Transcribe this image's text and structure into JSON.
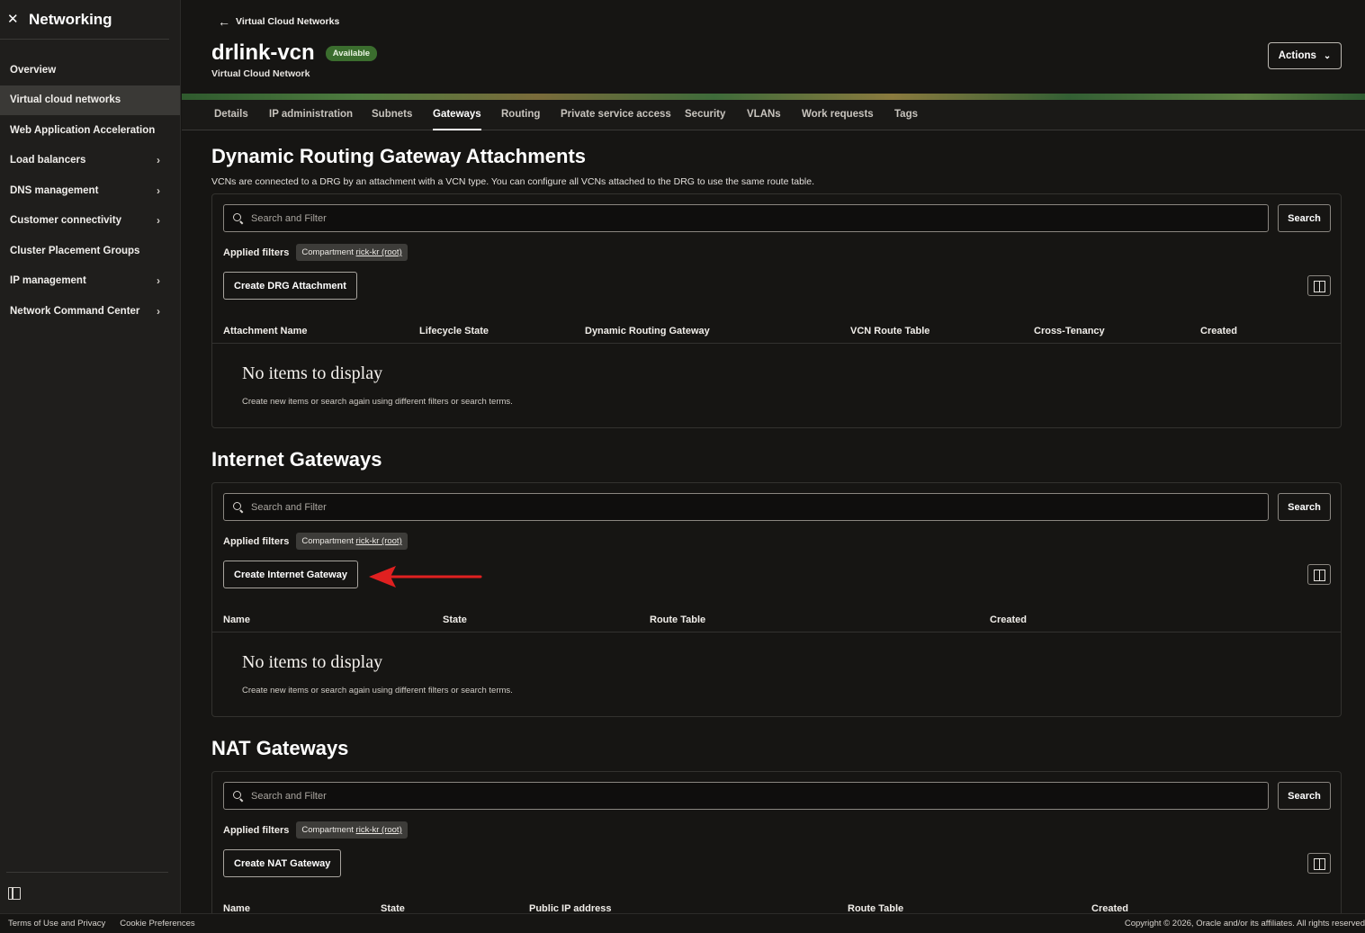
{
  "app": {
    "title": "Networking"
  },
  "sidebar": {
    "items": [
      {
        "label": "Overview",
        "active": false,
        "expandable": false
      },
      {
        "label": "Virtual cloud networks",
        "active": true,
        "expandable": false
      },
      {
        "label": "Web Application Acceleration",
        "active": false,
        "expandable": false
      },
      {
        "label": "Load balancers",
        "active": false,
        "expandable": true
      },
      {
        "label": "DNS management",
        "active": false,
        "expandable": true
      },
      {
        "label": "Customer connectivity",
        "active": false,
        "expandable": true
      },
      {
        "label": "Cluster Placement Groups",
        "active": false,
        "expandable": false
      },
      {
        "label": "IP management",
        "active": false,
        "expandable": true
      },
      {
        "label": "Network Command Center",
        "active": false,
        "expandable": true
      }
    ]
  },
  "header": {
    "back_label": "Virtual Cloud Networks",
    "title": "drlink-vcn",
    "status": "Available",
    "subtitle": "Virtual Cloud Network",
    "actions_label": "Actions"
  },
  "tabs": [
    {
      "label": "Details",
      "active": false
    },
    {
      "label": "IP administration",
      "active": false
    },
    {
      "label": "Subnets",
      "active": false
    },
    {
      "label": "Gateways",
      "active": true
    },
    {
      "label": "Routing",
      "active": false
    },
    {
      "label": "Private service access",
      "active": false
    },
    {
      "label": "Security",
      "active": false
    },
    {
      "label": "VLANs",
      "active": false
    },
    {
      "label": "Work requests",
      "active": false
    },
    {
      "label": "Tags",
      "active": false
    }
  ],
  "common": {
    "search_placeholder": "Search and Filter",
    "search_button": "Search",
    "applied_filters_label": "Applied filters",
    "compartment_prefix": "Compartment",
    "compartment_value": "rick-kr (root)",
    "empty_title": "No items to display",
    "empty_desc": "Create new items or search again using different filters or search terms."
  },
  "drg": {
    "title": "Dynamic Routing Gateway Attachments",
    "description": "VCNs are connected to a DRG by an attachment with a VCN type. You can configure all VCNs attached to the DRG to use the same route table.",
    "create_label": "Create DRG Attachment",
    "columns": [
      "Attachment Name",
      "Lifecycle State",
      "Dynamic Routing Gateway",
      "VCN Route Table",
      "Cross-Tenancy",
      "Created"
    ]
  },
  "igw": {
    "title": "Internet Gateways",
    "create_label": "Create Internet Gateway",
    "columns": [
      "Name",
      "State",
      "Route Table",
      "Created"
    ]
  },
  "nat": {
    "title": "NAT Gateways",
    "create_label": "Create NAT Gateway",
    "columns": [
      "Name",
      "State",
      "Public IP address",
      "Route Table",
      "Created"
    ]
  },
  "footer": {
    "terms": "Terms of Use and Privacy",
    "cookies": "Cookie Preferences",
    "copyright": "Copyright © 2026, Oracle and/or its affiliates. All rights reserved"
  },
  "colors": {
    "background": "#161513",
    "sidebar": "#1f1e1c",
    "status_badge": "#3b6d2e",
    "annotation_arrow": "#e02020"
  }
}
